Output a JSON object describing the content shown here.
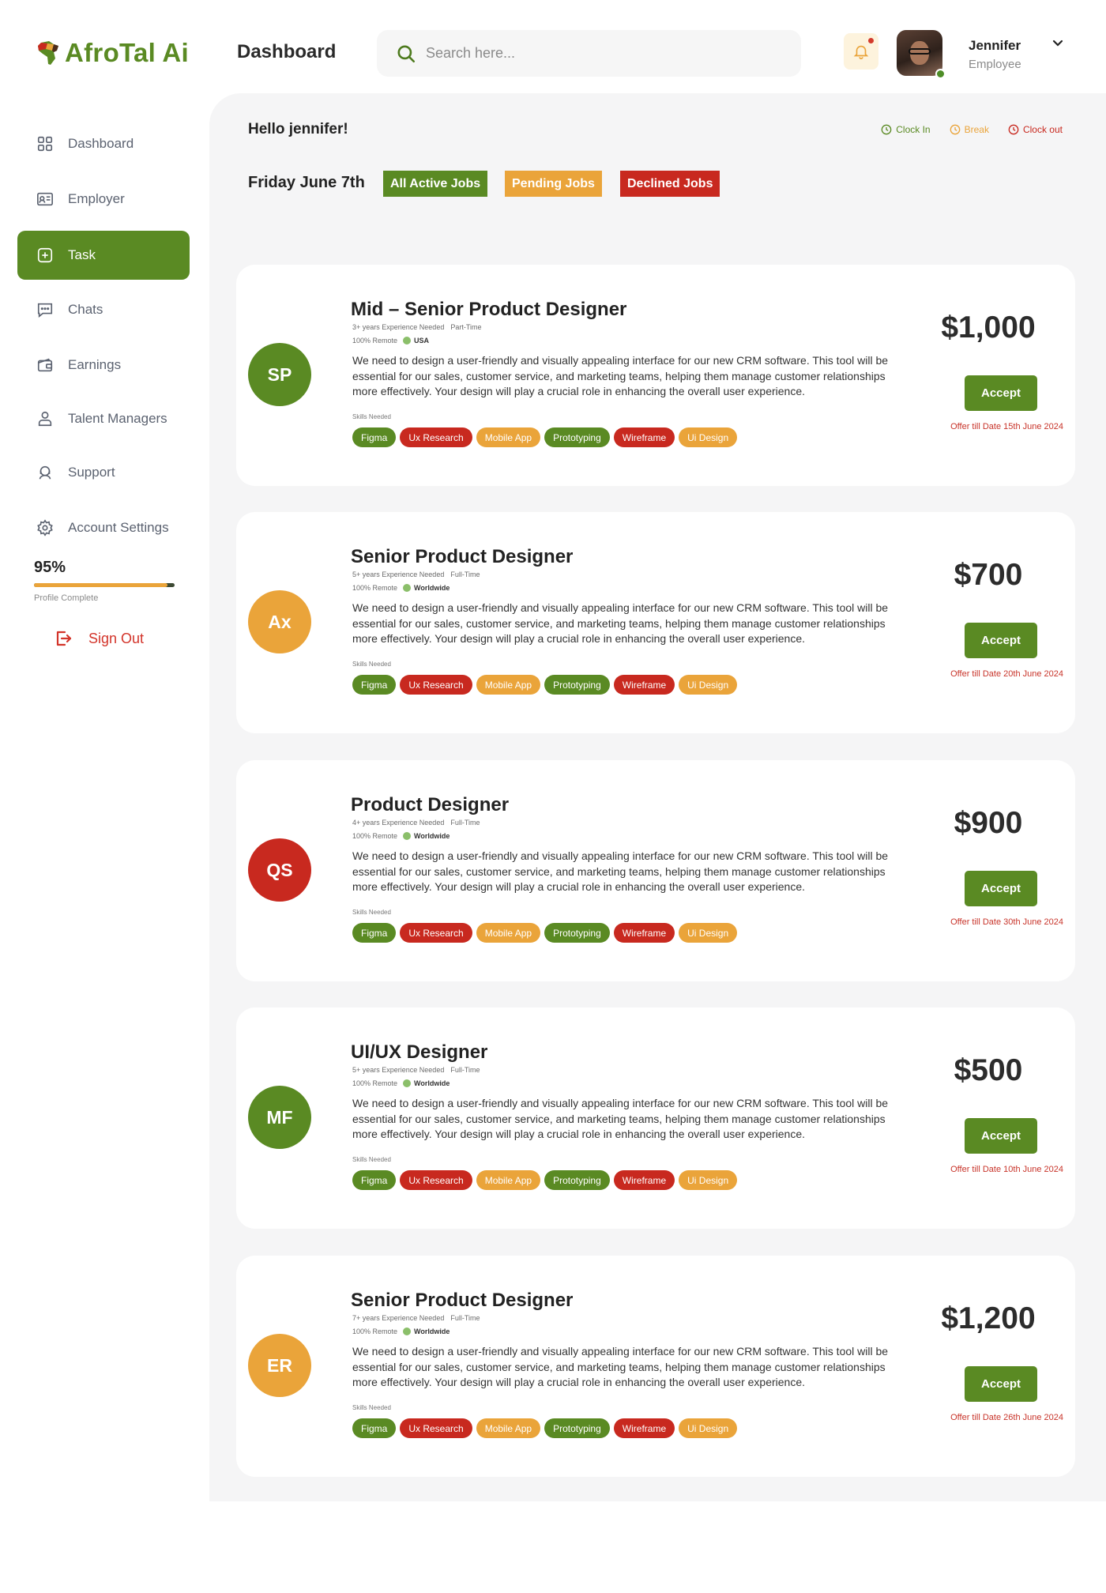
{
  "brand": {
    "name": "AfroTal Ai"
  },
  "header": {
    "title": "Dashboard",
    "search_placeholder": "Search here...",
    "user": {
      "name": "Jennifer",
      "role": "Employee"
    }
  },
  "sidebar": {
    "items": [
      {
        "label": "Dashboard",
        "icon": "grid-icon"
      },
      {
        "label": "Employer",
        "icon": "id-card-icon"
      },
      {
        "label": "Task",
        "icon": "plus-square-icon",
        "active": true
      },
      {
        "label": "Chats",
        "icon": "chat-icon"
      },
      {
        "label": "Earnings",
        "icon": "wallet-icon"
      },
      {
        "label": "Talent Managers",
        "icon": "person-icon"
      },
      {
        "label": "Support",
        "icon": "headset-icon"
      },
      {
        "label": "Account Settings",
        "icon": "gear-icon"
      }
    ],
    "profile": {
      "percent": "95%",
      "fraction": 0.95,
      "label": "Profile Complete"
    },
    "signout": "Sign Out"
  },
  "main": {
    "greeting": "Hello jennifer!",
    "clock": {
      "in": "Clock In",
      "break": "Break",
      "out": "Clock out"
    },
    "date": "Friday June 7th",
    "filters": [
      "All Active Jobs",
      "Pending Jobs",
      "Declined Jobs"
    ],
    "skills_label": "Skills Needed",
    "accept_label": "Accept",
    "jobs": [
      {
        "initials": "SP",
        "title": "Mid – Senior Product Designer",
        "experience": "3+ years Experience Needed",
        "type": "Part-Time",
        "remote": "100% Remote",
        "location": "USA",
        "description": "We need to design a user-friendly and visually appealing interface for our new CRM software. This tool will be essential for our sales, customer service, and marketing teams, helping them manage customer relationships more effectively. Your design will play a crucial role in enhancing the overall user experience.",
        "skills": [
          "Figma",
          "Ux Research",
          "Mobile App",
          "Prototyping",
          "Wireframe",
          "Ui Design"
        ],
        "price": "$1,000",
        "offer": "Offer till Date 15th June 2024"
      },
      {
        "initials": "Ax",
        "title": "Senior Product Designer",
        "experience": "5+ years Experience Needed",
        "type": "Full-Time",
        "remote": "100% Remote",
        "location": "Worldwide",
        "description": "We need to design a user-friendly and visually appealing interface for our new CRM software. This tool will be essential for our sales, customer service, and marketing teams, helping them manage customer relationships more effectively. Your design will play a crucial role in enhancing the overall user experience.",
        "skills": [
          "Figma",
          "Ux Research",
          "Mobile App",
          "Prototyping",
          "Wireframe",
          "Ui Design"
        ],
        "price": "$700",
        "offer": "Offer till Date 20th June 2024"
      },
      {
        "initials": "QS",
        "title": "Product Designer",
        "experience": "4+ years Experience Needed",
        "type": "Full-Time",
        "remote": "100% Remote",
        "location": "Worldwide",
        "description": "We need to design a user-friendly and visually appealing interface for our new CRM software. This tool will be essential for our sales, customer service, and marketing teams, helping them manage customer relationships more effectively. Your design will play a crucial role in enhancing the overall user experience.",
        "skills": [
          "Figma",
          "Ux Research",
          "Mobile App",
          "Prototyping",
          "Wireframe",
          "Ui Design"
        ],
        "price": "$900",
        "offer": "Offer till Date 30th June 2024"
      },
      {
        "initials": "MF",
        "title": "UI/UX Designer",
        "experience": "5+ years Experience Needed",
        "type": "Full-Time",
        "remote": "100% Remote",
        "location": "Worldwide",
        "description": "We need to design a user-friendly and visually appealing interface for our new CRM software. This tool will be essential for our sales, customer service, and marketing teams, helping them manage customer relationships more effectively. Your design will play a crucial role in enhancing the overall user experience.",
        "skills": [
          "Figma",
          "Ux Research",
          "Mobile App",
          "Prototyping",
          "Wireframe",
          "Ui Design"
        ],
        "price": "$500",
        "offer": "Offer till Date 10th June 2024"
      },
      {
        "initials": "ER",
        "title": "Senior Product Designer",
        "experience": "7+ years Experience Needed",
        "type": "Full-Time",
        "remote": "100% Remote",
        "location": "Worldwide",
        "description": "We need to design a user-friendly and visually appealing interface for our new CRM software. This tool will be essential for our sales, customer service, and marketing teams, helping them manage customer relationships more effectively. Your design will play a crucial role in enhancing the overall user experience.",
        "skills": [
          "Figma",
          "Ux Research",
          "Mobile App",
          "Prototyping",
          "Wireframe",
          "Ui Design"
        ],
        "price": "$1,200",
        "offer": "Offer till Date 26th June 2024"
      }
    ]
  },
  "colors": {
    "green": "#5a8a23",
    "orange": "#eaa43a",
    "red": "#c8291f",
    "avatar_colors": [
      "#5a8a23",
      "#eaa43a",
      "#c8291f",
      "#5a8a23",
      "#eaa43a"
    ],
    "skill_colors": [
      "#5a8a23",
      "#c8291f",
      "#eaa43a",
      "#5a8a23",
      "#c8291f",
      "#eaa43a"
    ]
  }
}
